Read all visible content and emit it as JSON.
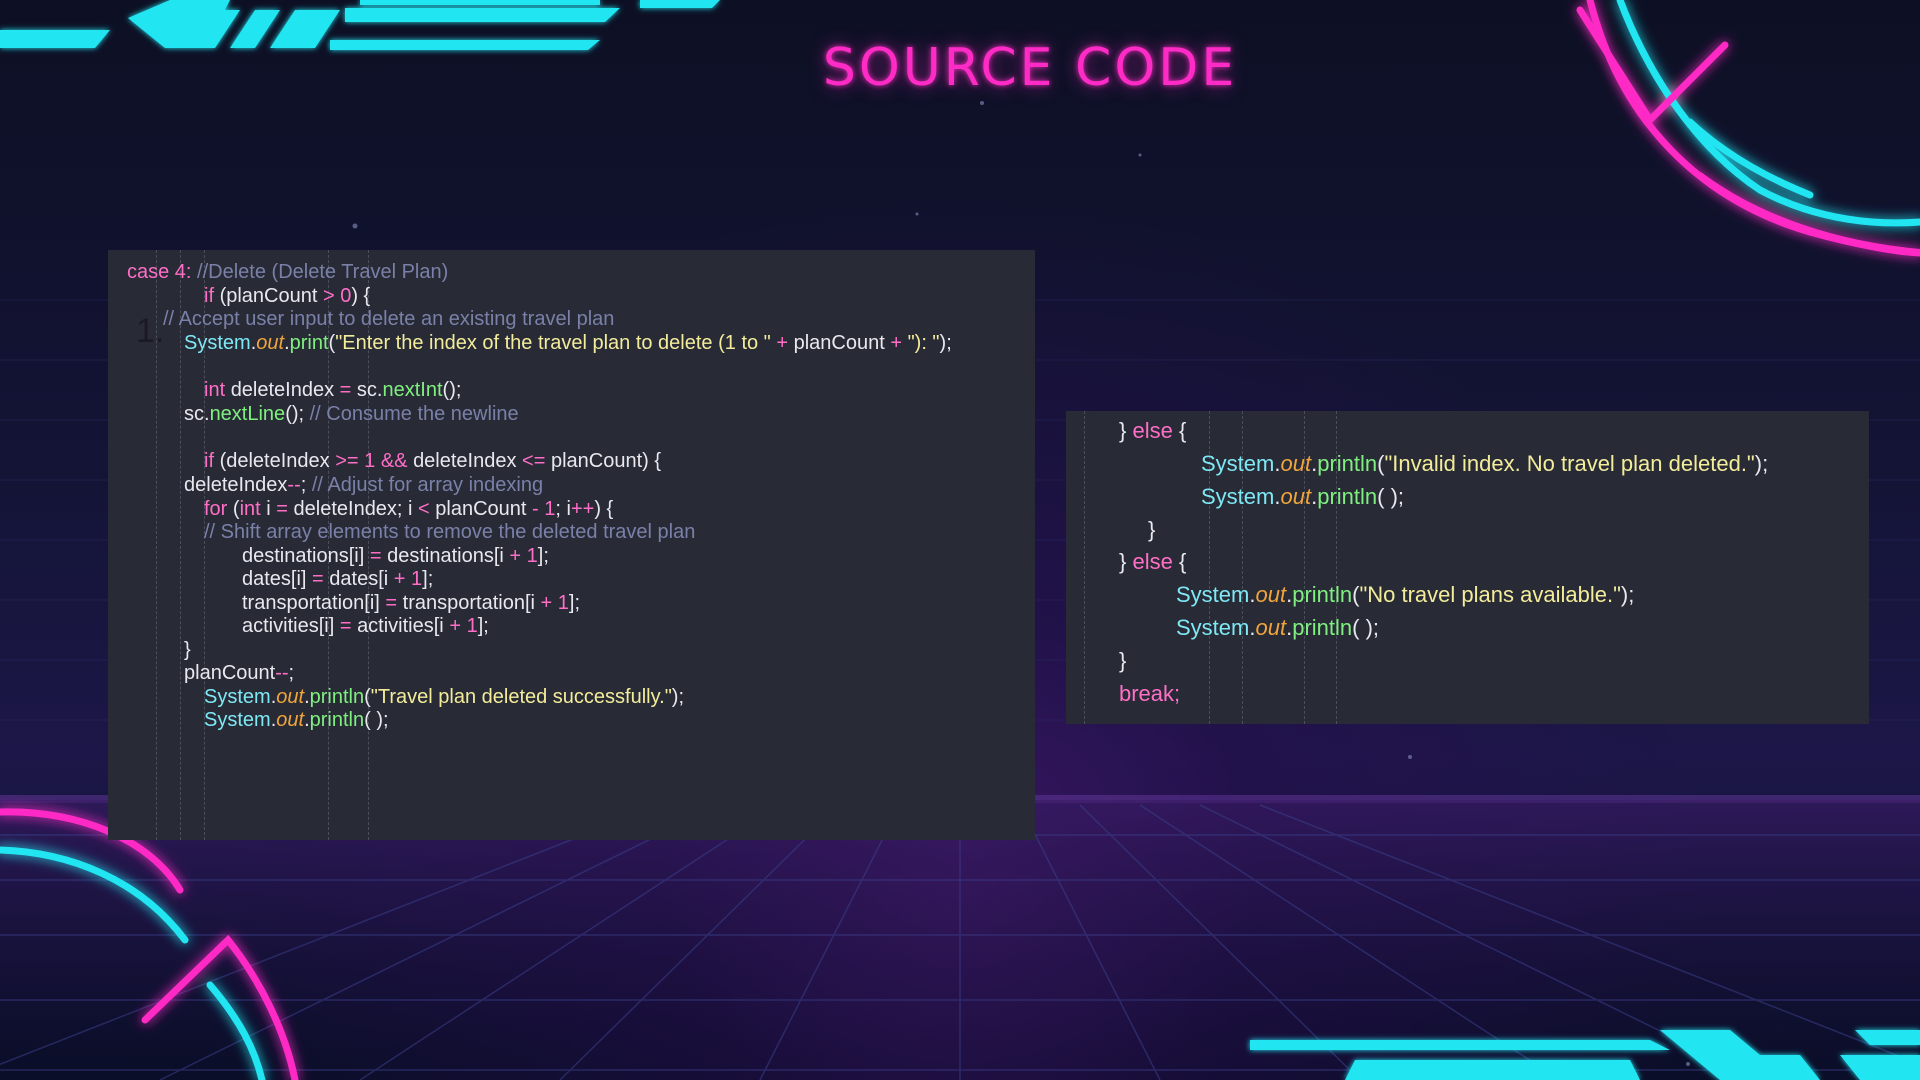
{
  "title": "SOURCE CODE",
  "list_marker": "1.",
  "colors": {
    "magenta": "#ff2bc6",
    "cyan": "#22e5f2",
    "panel_bg": "#282b36",
    "keyword": "#ff6ec7",
    "comment": "#7a80a8",
    "string": "#f3ec9b",
    "method": "#7ff07f",
    "field": "#f0a53c",
    "class": "#7ee8f5"
  },
  "code_left": [
    [
      {
        "t": "case 4: ",
        "c": "kw"
      },
      {
        "t": "//Delete (Delete Travel Plan)",
        "c": "cm"
      }
    ],
    [
      {
        "t": "if ",
        "c": "kw"
      },
      {
        "t": "(planCount ",
        "c": "pl"
      },
      {
        "t": "> ",
        "c": "op"
      },
      {
        "t": "0",
        "c": "num"
      },
      {
        "t": ") {",
        "c": "pl"
      }
    ],
    [
      {
        "t": "// Accept user input to delete an existing travel plan",
        "c": "cm"
      }
    ],
    [
      {
        "t": "System",
        "c": "obj"
      },
      {
        "t": ".",
        "c": "pl"
      },
      {
        "t": "out",
        "c": "fld"
      },
      {
        "t": ".",
        "c": "pl"
      },
      {
        "t": "print",
        "c": "mth"
      },
      {
        "t": "(",
        "c": "pl"
      },
      {
        "t": "\"Enter the index of the travel plan to delete (1 to \"",
        "c": "str"
      },
      {
        "t": " + ",
        "c": "op"
      },
      {
        "t": "planCount",
        "c": "pl"
      },
      {
        "t": " + ",
        "c": "op"
      },
      {
        "t": "\"): \"",
        "c": "str"
      },
      {
        "t": ");",
        "c": "pl"
      }
    ],
    [],
    [
      {
        "t": "int ",
        "c": "kw"
      },
      {
        "t": "deleteIndex ",
        "c": "pl"
      },
      {
        "t": "= ",
        "c": "op"
      },
      {
        "t": "sc.",
        "c": "pl"
      },
      {
        "t": "nextInt",
        "c": "mth"
      },
      {
        "t": "();",
        "c": "pl"
      }
    ],
    [
      {
        "t": "sc.",
        "c": "pl"
      },
      {
        "t": "nextLine",
        "c": "mth"
      },
      {
        "t": "(); ",
        "c": "pl"
      },
      {
        "t": "// Consume the newline",
        "c": "cm"
      }
    ],
    [],
    [
      {
        "t": "if ",
        "c": "kw"
      },
      {
        "t": "(deleteIndex ",
        "c": "pl"
      },
      {
        "t": ">= ",
        "c": "op"
      },
      {
        "t": "1 ",
        "c": "num"
      },
      {
        "t": "&& ",
        "c": "op"
      },
      {
        "t": "deleteIndex ",
        "c": "pl"
      },
      {
        "t": "<= ",
        "c": "op"
      },
      {
        "t": "planCount) {",
        "c": "pl"
      }
    ],
    [
      {
        "t": "deleteIndex",
        "c": "pl"
      },
      {
        "t": "--",
        "c": "op"
      },
      {
        "t": "; ",
        "c": "pl"
      },
      {
        "t": "// Adjust for array indexing",
        "c": "cm"
      }
    ],
    [
      {
        "t": "for ",
        "c": "kw"
      },
      {
        "t": "(",
        "c": "pl"
      },
      {
        "t": "int ",
        "c": "kw"
      },
      {
        "t": "i ",
        "c": "pl"
      },
      {
        "t": "= ",
        "c": "op"
      },
      {
        "t": "deleteIndex; i ",
        "c": "pl"
      },
      {
        "t": "< ",
        "c": "op"
      },
      {
        "t": "planCount ",
        "c": "pl"
      },
      {
        "t": "- ",
        "c": "op"
      },
      {
        "t": "1",
        "c": "num"
      },
      {
        "t": "; i",
        "c": "pl"
      },
      {
        "t": "++",
        "c": "op"
      },
      {
        "t": ") {",
        "c": "pl"
      }
    ],
    [
      {
        "t": "// Shift array elements to remove the deleted travel plan",
        "c": "cm"
      }
    ],
    [
      {
        "t": "destinations[i] ",
        "c": "pl"
      },
      {
        "t": "= ",
        "c": "op"
      },
      {
        "t": "destinations[i ",
        "c": "pl"
      },
      {
        "t": "+ ",
        "c": "op"
      },
      {
        "t": "1",
        "c": "num"
      },
      {
        "t": "];",
        "c": "pl"
      }
    ],
    [
      {
        "t": "dates[i] ",
        "c": "pl"
      },
      {
        "t": "= ",
        "c": "op"
      },
      {
        "t": "dates[i ",
        "c": "pl"
      },
      {
        "t": "+ ",
        "c": "op"
      },
      {
        "t": "1",
        "c": "num"
      },
      {
        "t": "];",
        "c": "pl"
      }
    ],
    [
      {
        "t": "transportation[i] ",
        "c": "pl"
      },
      {
        "t": "= ",
        "c": "op"
      },
      {
        "t": "transportation[i ",
        "c": "pl"
      },
      {
        "t": "+ ",
        "c": "op"
      },
      {
        "t": "1",
        "c": "num"
      },
      {
        "t": "];",
        "c": "pl"
      }
    ],
    [
      {
        "t": "activities[i] ",
        "c": "pl"
      },
      {
        "t": "= ",
        "c": "op"
      },
      {
        "t": "activities[i ",
        "c": "pl"
      },
      {
        "t": "+ ",
        "c": "op"
      },
      {
        "t": "1",
        "c": "num"
      },
      {
        "t": "];",
        "c": "pl"
      }
    ],
    [
      {
        "t": "}",
        "c": "pl"
      }
    ],
    [
      {
        "t": "planCount",
        "c": "pl"
      },
      {
        "t": "--",
        "c": "op"
      },
      {
        "t": ";",
        "c": "pl"
      }
    ],
    [
      {
        "t": "System",
        "c": "obj"
      },
      {
        "t": ".",
        "c": "pl"
      },
      {
        "t": "out",
        "c": "fld"
      },
      {
        "t": ".",
        "c": "pl"
      },
      {
        "t": "println",
        "c": "mth"
      },
      {
        "t": "(",
        "c": "pl"
      },
      {
        "t": "\"Travel plan deleted successfully.\"",
        "c": "str"
      },
      {
        "t": ");",
        "c": "pl"
      }
    ],
    [
      {
        "t": "System",
        "c": "obj"
      },
      {
        "t": ".",
        "c": "pl"
      },
      {
        "t": "out",
        "c": "fld"
      },
      {
        "t": ".",
        "c": "pl"
      },
      {
        "t": "println",
        "c": "mth"
      },
      {
        "t": "( );",
        "c": "pl"
      }
    ]
  ],
  "code_right": [
    [
      {
        "t": "} ",
        "c": "pl"
      },
      {
        "t": "else ",
        "c": "kw"
      },
      {
        "t": "{",
        "c": "pl"
      }
    ],
    [
      {
        "t": "System",
        "c": "obj"
      },
      {
        "t": ".",
        "c": "pl"
      },
      {
        "t": "out",
        "c": "fld"
      },
      {
        "t": ".",
        "c": "pl"
      },
      {
        "t": "println",
        "c": "mth"
      },
      {
        "t": "(",
        "c": "pl"
      },
      {
        "t": "\"Invalid index. No travel plan deleted.\"",
        "c": "str"
      },
      {
        "t": ");",
        "c": "pl"
      }
    ],
    [
      {
        "t": "System",
        "c": "obj"
      },
      {
        "t": ".",
        "c": "pl"
      },
      {
        "t": "out",
        "c": "fld"
      },
      {
        "t": ".",
        "c": "pl"
      },
      {
        "t": "println",
        "c": "mth"
      },
      {
        "t": "( );",
        "c": "pl"
      }
    ],
    [
      {
        "t": "}",
        "c": "pl"
      }
    ],
    [
      {
        "t": "} ",
        "c": "pl"
      },
      {
        "t": "else ",
        "c": "kw"
      },
      {
        "t": "{",
        "c": "pl"
      }
    ],
    [
      {
        "t": "System",
        "c": "obj"
      },
      {
        "t": ".",
        "c": "pl"
      },
      {
        "t": "out",
        "c": "fld"
      },
      {
        "t": ".",
        "c": "pl"
      },
      {
        "t": "println",
        "c": "mth"
      },
      {
        "t": "(",
        "c": "pl"
      },
      {
        "t": "\"No travel plans available.\"",
        "c": "str"
      },
      {
        "t": ");",
        "c": "pl"
      }
    ],
    [
      {
        "t": "System",
        "c": "obj"
      },
      {
        "t": ".",
        "c": "pl"
      },
      {
        "t": "out",
        "c": "fld"
      },
      {
        "t": ".",
        "c": "pl"
      },
      {
        "t": "println",
        "c": "mth"
      },
      {
        "t": "( );",
        "c": "pl"
      }
    ],
    [
      {
        "t": "}",
        "c": "pl"
      }
    ],
    [
      {
        "t": "break;",
        "c": "kw"
      }
    ]
  ]
}
